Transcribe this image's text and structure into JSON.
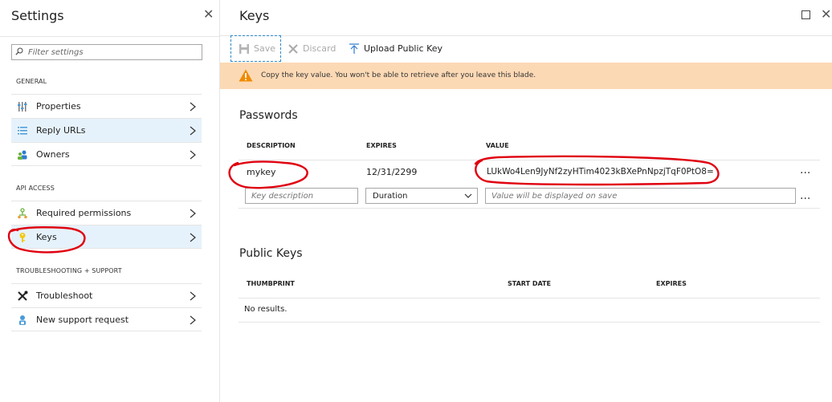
{
  "settings": {
    "title": "Settings",
    "filter_placeholder": "Filter settings",
    "sections": [
      {
        "header": "GENERAL",
        "items": [
          {
            "label": "Properties",
            "icon": "properties-icon"
          },
          {
            "label": "Reply URLs",
            "icon": "list-icon"
          },
          {
            "label": "Owners",
            "icon": "owners-icon"
          }
        ]
      },
      {
        "header": "API ACCESS",
        "items": [
          {
            "label": "Required permissions",
            "icon": "permissions-icon"
          },
          {
            "label": "Keys",
            "icon": "key-icon",
            "selected": true
          }
        ]
      },
      {
        "header": "TROUBLESHOOTING + SUPPORT",
        "items": [
          {
            "label": "Troubleshoot",
            "icon": "tools-icon"
          },
          {
            "label": "New support request",
            "icon": "support-icon"
          }
        ]
      }
    ]
  },
  "keys": {
    "title": "Keys",
    "toolbar": {
      "save": "Save",
      "discard": "Discard",
      "upload": "Upload Public Key"
    },
    "warning": "Copy the key value. You won't be able to retrieve after you leave this blade.",
    "passwords": {
      "title": "Passwords",
      "columns": [
        "DESCRIPTION",
        "EXPIRES",
        "VALUE"
      ],
      "rows": [
        {
          "description": "mykey",
          "expires": "12/31/2299",
          "value": "LUkWo4Len9JyNf2zyHTim4023kBXePnNpzjTqF0PtO8="
        }
      ],
      "new_row": {
        "description_placeholder": "Key description",
        "duration": "Duration",
        "value_placeholder": "Value will be displayed on save"
      },
      "more": "..."
    },
    "public_keys": {
      "title": "Public Keys",
      "columns": [
        "THUMBPRINT",
        "START DATE",
        "EXPIRES"
      ],
      "empty": "No results."
    }
  },
  "colors": {
    "selected_bg": "#e6f2fb",
    "warning_bg": "#fcd9b5",
    "accent": "#2b8acb",
    "annotation": "#e0000f"
  }
}
